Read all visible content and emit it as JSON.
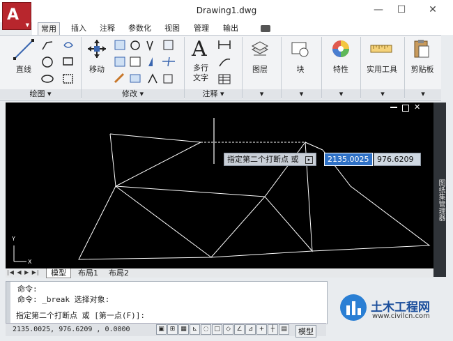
{
  "window": {
    "title": "Drawing1.dwg",
    "minimize": "—",
    "maximize": "☐",
    "close": "✕"
  },
  "app_button": {
    "logo": "A"
  },
  "tabs": [
    "常用",
    "插入",
    "注释",
    "参数化",
    "视图",
    "管理",
    "输出"
  ],
  "ribbon": {
    "line_label": "直线",
    "move_label": "移动",
    "mtext_label_1": "多行",
    "mtext_label_2": "文字",
    "layer_label": "图层",
    "block_label": "块",
    "properties_label": "特性",
    "utilities_label": "实用工具",
    "clipboard_label": "剪贴板",
    "panel_draw": "绘图 ▾",
    "panel_modify": "修改 ▾",
    "panel_annotation": "注释 ▾"
  },
  "dynamic_input": {
    "prompt": "指定第二个打断点 或",
    "x_value": "2135.0025",
    "y_value": "976.6209"
  },
  "layout_tabs": [
    "模型",
    "布局1",
    "布局2"
  ],
  "palette": {
    "label": "图纸集管理器"
  },
  "command_lines": [
    "命令:",
    "命令: _break 选择对象:",
    "指定第二个打断点 或 [第一点(F)]:"
  ],
  "status": {
    "coords": "2135.0025, 976.6209 , 0.0000",
    "model": "模型"
  },
  "ucs": {
    "x": "X",
    "y": "Y"
  },
  "watermark": {
    "name": "土木工程网",
    "url": "www.civilcn.com"
  }
}
